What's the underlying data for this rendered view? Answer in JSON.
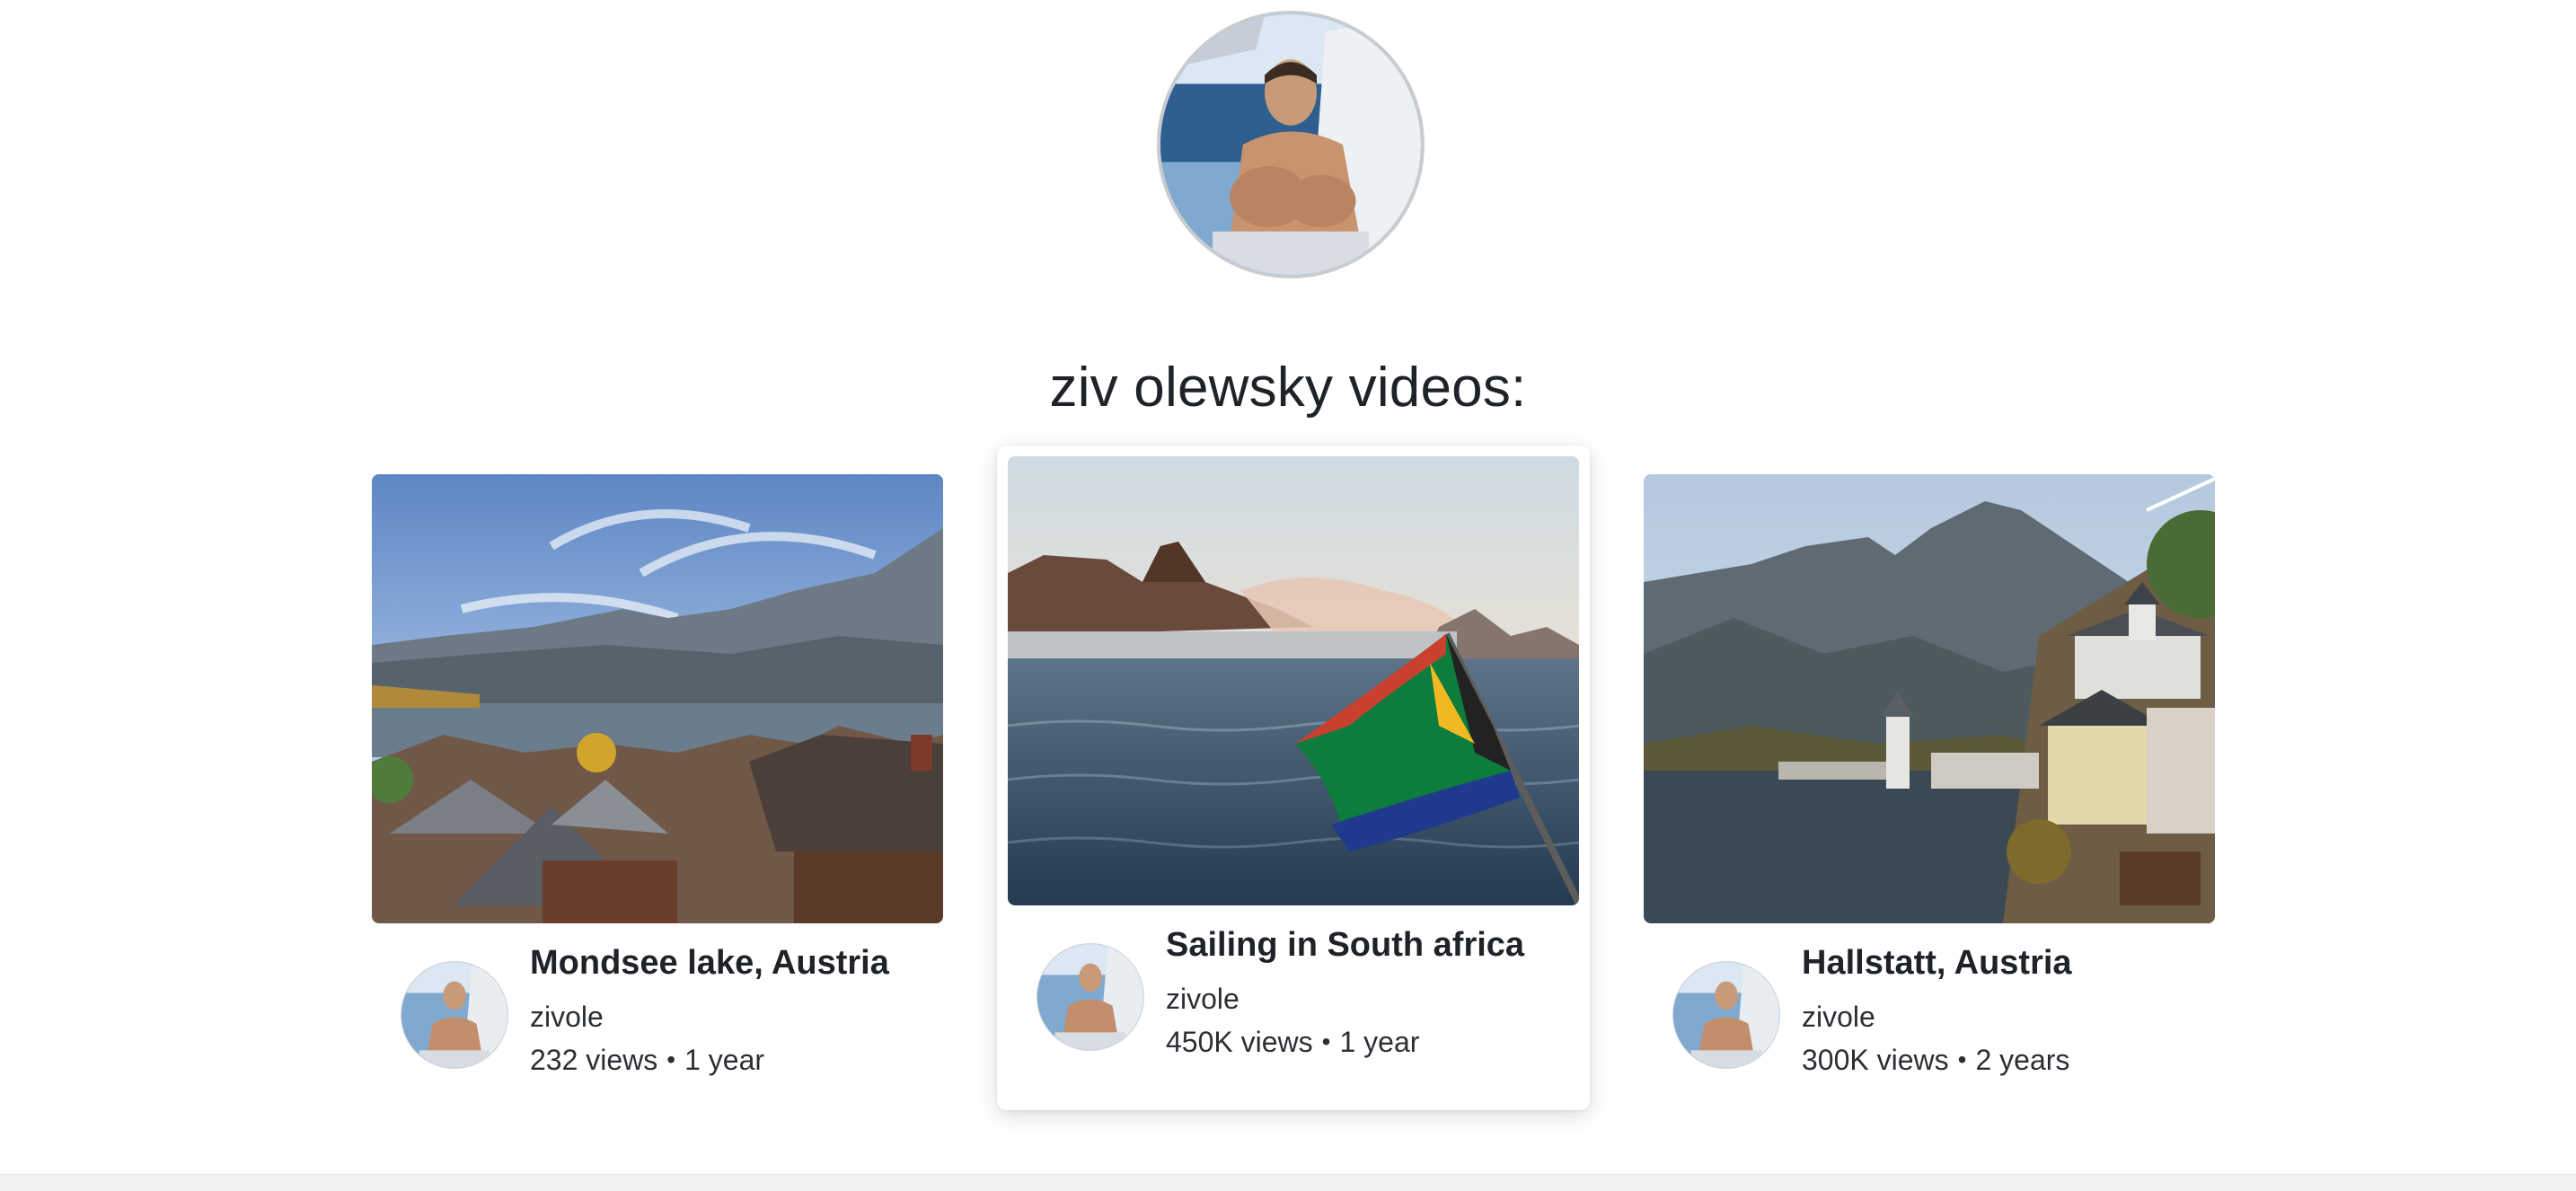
{
  "profile": {
    "avatar_icon": "profile-photo",
    "title": "ziv olewsky videos:"
  },
  "videos": [
    {
      "title": "Mondsee lake, Austria",
      "channel": "zivole",
      "views": "232 views",
      "separator": "•",
      "age": "1 year",
      "thumbnail": "lake-mountains-village-thumbnail",
      "hovered": false
    },
    {
      "title": "Sailing in South africa",
      "channel": "zivole",
      "views": "450K views",
      "separator": "•",
      "age": "1 year",
      "thumbnail": "sea-flag-mountain-thumbnail",
      "hovered": true
    },
    {
      "title": "Hallstatt, Austria",
      "channel": "zivole",
      "views": "300K views",
      "separator": "•",
      "age": "2 years",
      "thumbnail": "alpine-village-lake-thumbnail",
      "hovered": false
    }
  ],
  "colors": {
    "background": "#ffffff",
    "text": "#1f2328",
    "card_shadow": "rgba(0,0,0,0.14)"
  }
}
